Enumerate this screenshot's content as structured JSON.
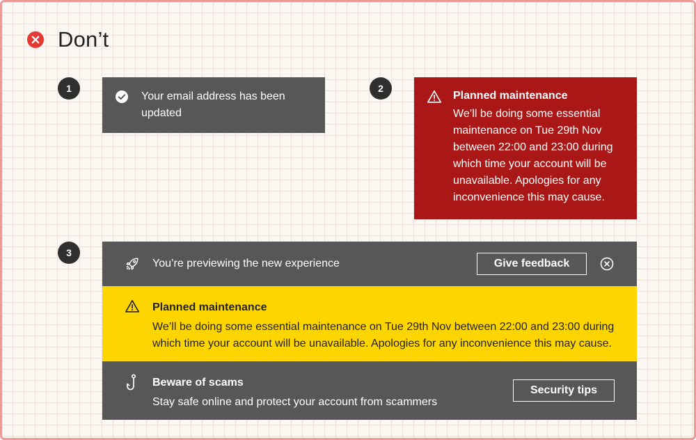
{
  "header": {
    "title": "Don’t",
    "icon": "close-circle-icon",
    "icon_color": "#e53935"
  },
  "example1": {
    "number": "1",
    "icon": "check-circle-icon",
    "message": "Your email address has been updated",
    "bg_color": "#575757"
  },
  "example2": {
    "number": "2",
    "icon": "warning-icon",
    "title": "Planned maintenance",
    "message": "We’ll be doing some essential maintenance on Tue 29th Nov between 22:00 and 23:00 during which time your account will be unavailable. Apologies for any inconvenience this may cause.",
    "bg_color": "#aa1717"
  },
  "example3": {
    "number": "3",
    "preview": {
      "icon": "rocket-icon",
      "message": "You’re previewing the new experience",
      "button_label": "Give feedback",
      "close_icon": "close-circle-outline-icon"
    },
    "maintenance": {
      "icon": "warning-icon",
      "title": "Planned maintenance",
      "message": "We’ll be doing some essential maintenance on Tue 29th Nov between 22:00 and 23:00 during which time your account will be unavailable. Apologies for any inconvenience this may cause.",
      "bg_color": "#ffd500"
    },
    "scams": {
      "icon": "fishing-hook-icon",
      "title": "Beware of scams",
      "message": "Stay safe online and protect your account from scammers",
      "button_label": "Security tips"
    }
  }
}
